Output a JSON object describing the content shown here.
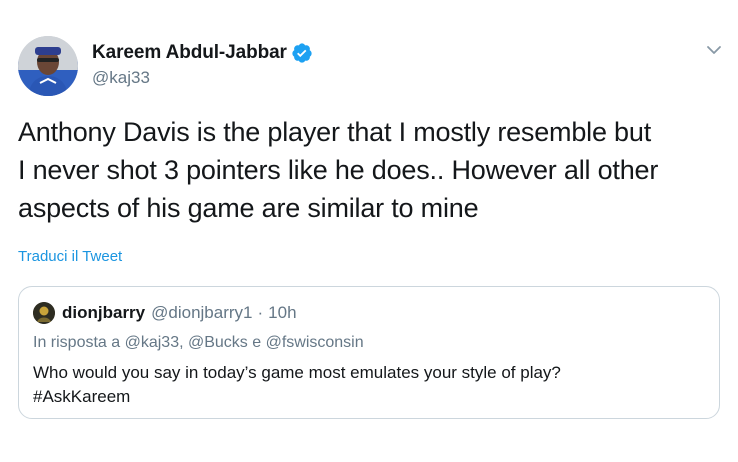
{
  "tweet": {
    "author": {
      "display_name": "Kareem Abdul-Jabbar",
      "handle": "@kaj33",
      "verified": true,
      "avatar_icon": "avatar"
    },
    "menu_icon": "chevron-down-icon",
    "text": "Anthony Davis is the player that I mostly resemble but\nI never shot 3 pointers like he does.. However all other\naspects of his game are similar to mine",
    "translate_label": "Traduci il Tweet"
  },
  "quoted_tweet": {
    "display_name": "dionjbarry",
    "handle": "@dionjbarry1",
    "separator": "·",
    "time": "10h",
    "reply_context": "In risposta a @kaj33, @Bucks e @fswisconsin",
    "text": "Who would you say in today’s game most emulates your style of play?\n#AskKareem"
  },
  "colors": {
    "text_primary": "#14171a",
    "text_secondary": "#657786",
    "link": "#1b95e0",
    "verified": "#1da1f2",
    "border": "#ccd6dd"
  }
}
